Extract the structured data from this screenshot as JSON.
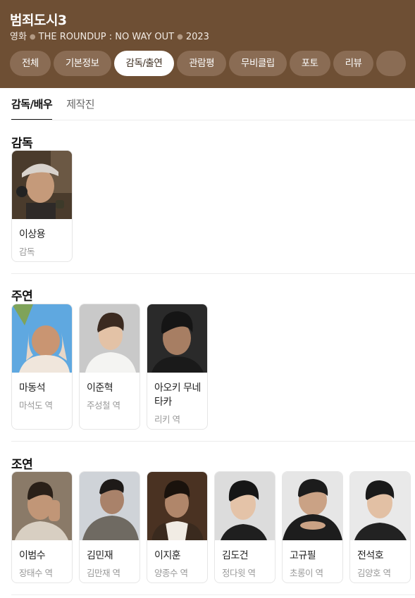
{
  "header": {
    "title": "범죄도시3",
    "meta": {
      "type": "영화",
      "english_title": "THE ROUNDUP : NO WAY OUT",
      "year": "2023"
    },
    "tabs": [
      {
        "label": "전체",
        "active": false
      },
      {
        "label": "기본정보",
        "active": false
      },
      {
        "label": "감독/출연",
        "active": true
      },
      {
        "label": "관람평",
        "active": false
      },
      {
        "label": "무비클립",
        "active": false
      },
      {
        "label": "포토",
        "active": false
      },
      {
        "label": "리뷰",
        "active": false
      }
    ]
  },
  "subtabs": [
    {
      "label": "감독/배우",
      "active": true
    },
    {
      "label": "제작진",
      "active": false
    }
  ],
  "sections": {
    "director": {
      "title": "감독",
      "people": [
        {
          "name": "이상용",
          "role": "감독"
        }
      ]
    },
    "lead": {
      "title": "주연",
      "people": [
        {
          "name": "마동석",
          "role": "마석도 역"
        },
        {
          "name": "이준혁",
          "role": "주성철 역"
        },
        {
          "name": "아오키 무네타카",
          "role": "리키 역"
        }
      ]
    },
    "supporting": {
      "title": "조연",
      "people": [
        {
          "name": "이범수",
          "role": "장태수 역"
        },
        {
          "name": "김민재",
          "role": "김만재 역"
        },
        {
          "name": "이지훈",
          "role": "양종수 역"
        },
        {
          "name": "김도건",
          "role": "정다윗 역"
        },
        {
          "name": "고규필",
          "role": "초롱이 역"
        },
        {
          "name": "전석호",
          "role": "김양호 역"
        }
      ]
    }
  },
  "colors": {
    "header_bg": "#6e4f34",
    "tab_bg": "#8a6c54",
    "active_tab_bg": "#ffffff"
  }
}
